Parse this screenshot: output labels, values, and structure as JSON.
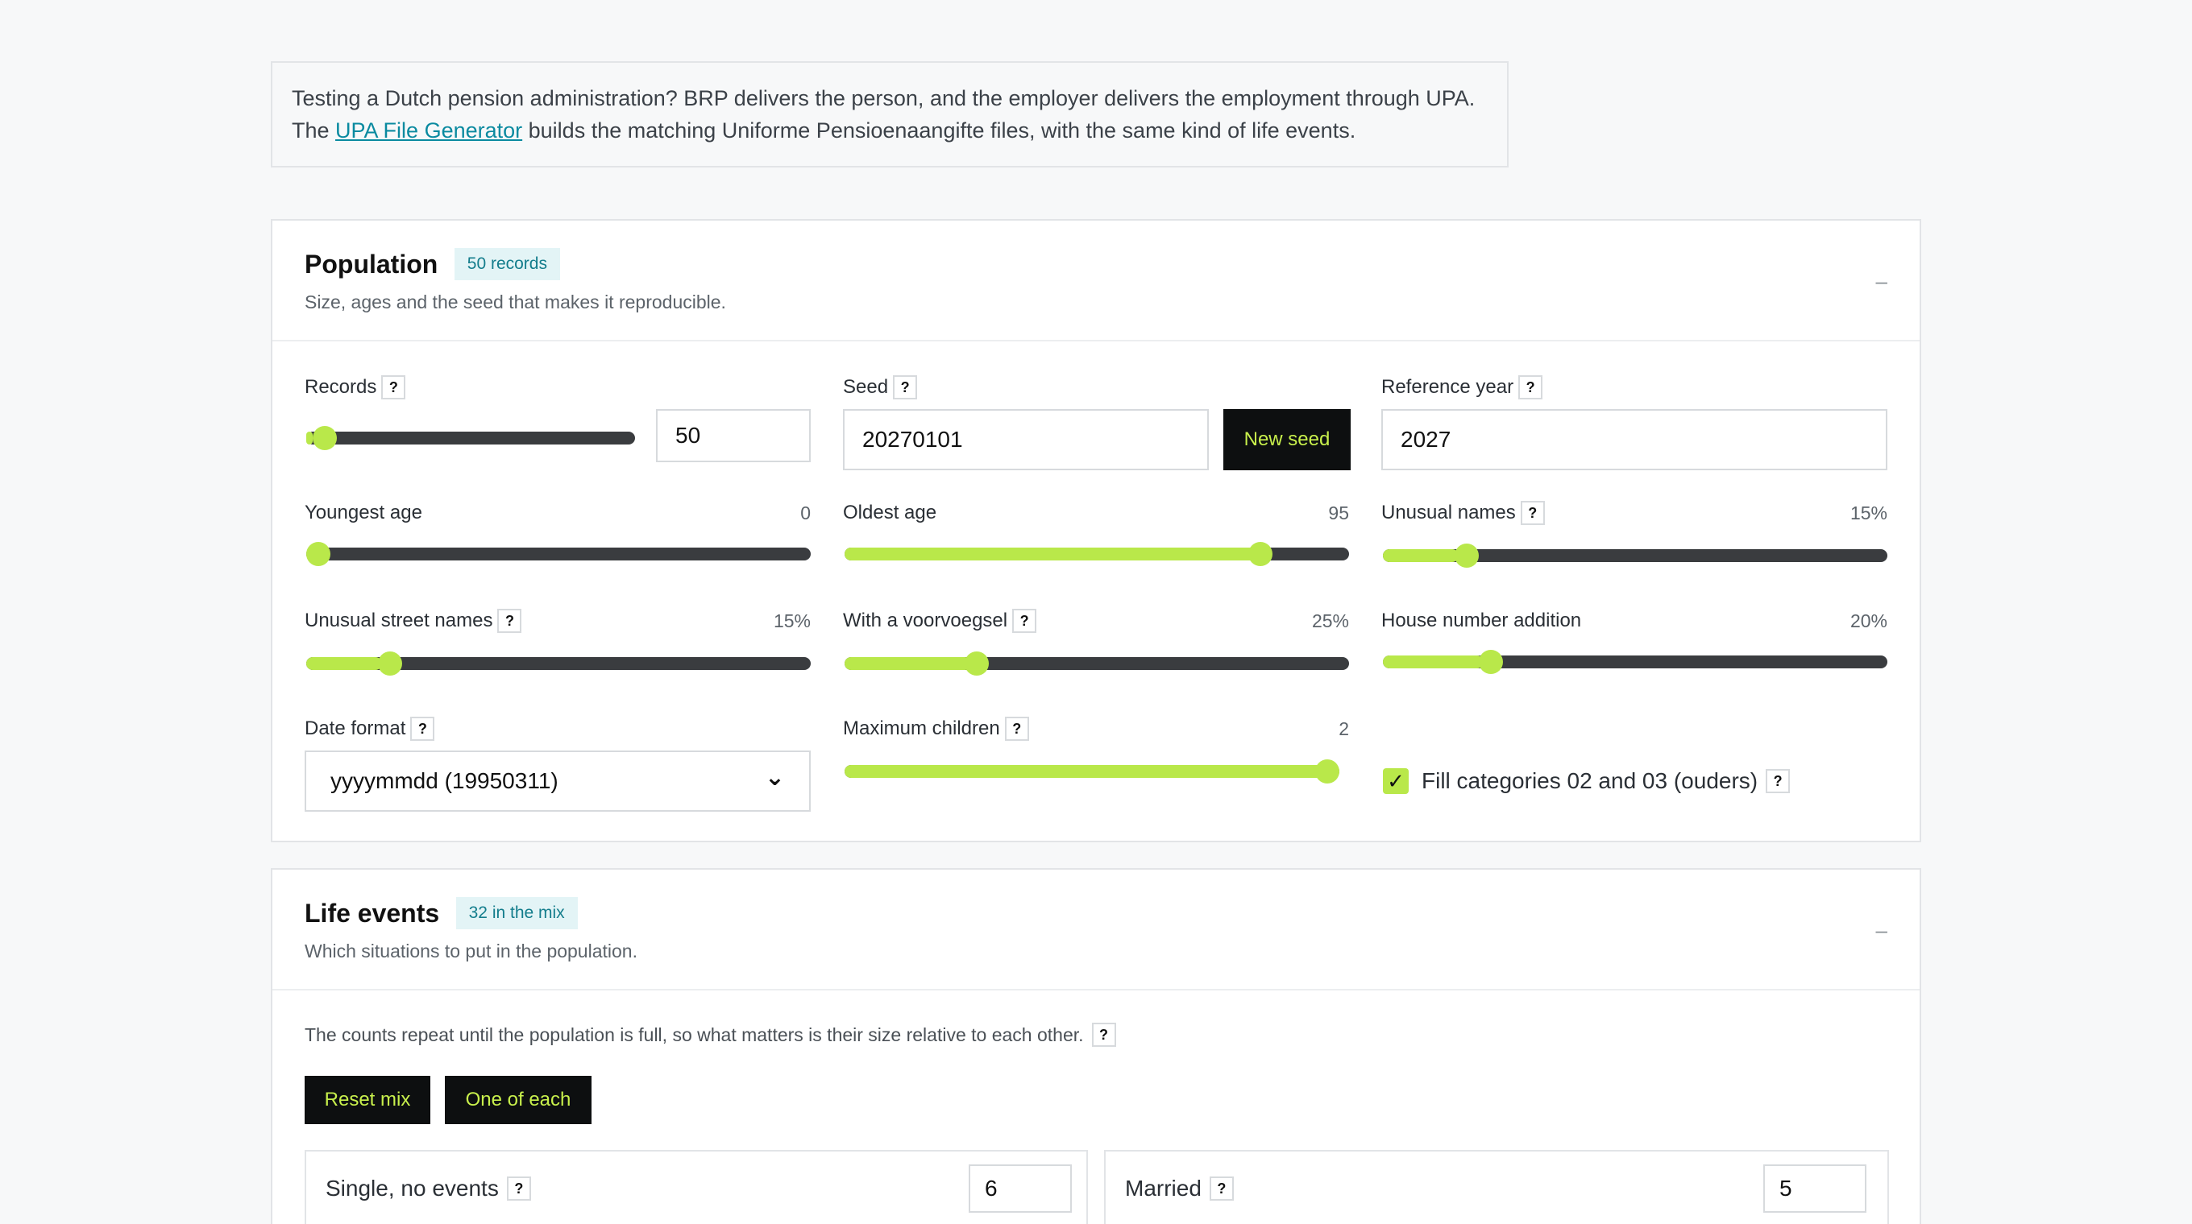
{
  "intro": {
    "text_before": "Testing a Dutch pension administration? BRP delivers the person, and the employer delivers the employment through UPA. The ",
    "link": "UPA File Generator",
    "text_after": " builds the matching Uniforme Pensioenaangifte files, with the same kind of life events."
  },
  "population": {
    "title": "Population",
    "badge": "50 records",
    "subtitle": "Size, ages and the seed that makes it reproducible.",
    "collapse": "–",
    "records": {
      "label": "Records",
      "value": "50",
      "fraction": 0.02
    },
    "seed": {
      "label": "Seed",
      "value": "20270101",
      "button": "New seed"
    },
    "reference_year": {
      "label": "Reference year",
      "value": "2027"
    },
    "youngest_age": {
      "label": "Youngest age",
      "value": "0",
      "fraction": 0.0
    },
    "oldest_age": {
      "label": "Oldest age",
      "value": "95",
      "fraction": 0.84
    },
    "unusual_names": {
      "label": "Unusual names",
      "value": "15%",
      "fraction": 0.15
    },
    "unusual_street_names": {
      "label": "Unusual street names",
      "value": "15%",
      "fraction": 0.15
    },
    "voorvoegsel": {
      "label": "With a voorvoegsel",
      "value": "25%",
      "fraction": 0.25
    },
    "house_number_addition": {
      "label": "House number addition",
      "value": "20%",
      "fraction": 0.2
    },
    "date_format": {
      "label": "Date format",
      "value": "yyyymmdd (19950311)"
    },
    "max_children": {
      "label": "Maximum children",
      "value": "2",
      "fraction": 1.0
    },
    "fill_categories": {
      "label": "Fill categories 02 and 03 (ouders)",
      "checked": true
    }
  },
  "life_events": {
    "title": "Life events",
    "badge": "32 in the mix",
    "subtitle": "Which situations to put in the population.",
    "collapse": "–",
    "note": "The counts repeat until the population is full, so what matters is their size relative to each other.",
    "reset_button": "Reset mix",
    "one_each_button": "One of each",
    "items": [
      {
        "label": "Single, no events",
        "value": "6"
      },
      {
        "label": "Married",
        "value": "5"
      }
    ]
  },
  "help_glyph": "?",
  "check_glyph": "✓",
  "select_arrow": "⌄",
  "colors": {
    "accent": "#b9e84a",
    "dark": "#0d0f10",
    "link": "#0a8aa0",
    "badge_bg": "#e3f4f6"
  }
}
